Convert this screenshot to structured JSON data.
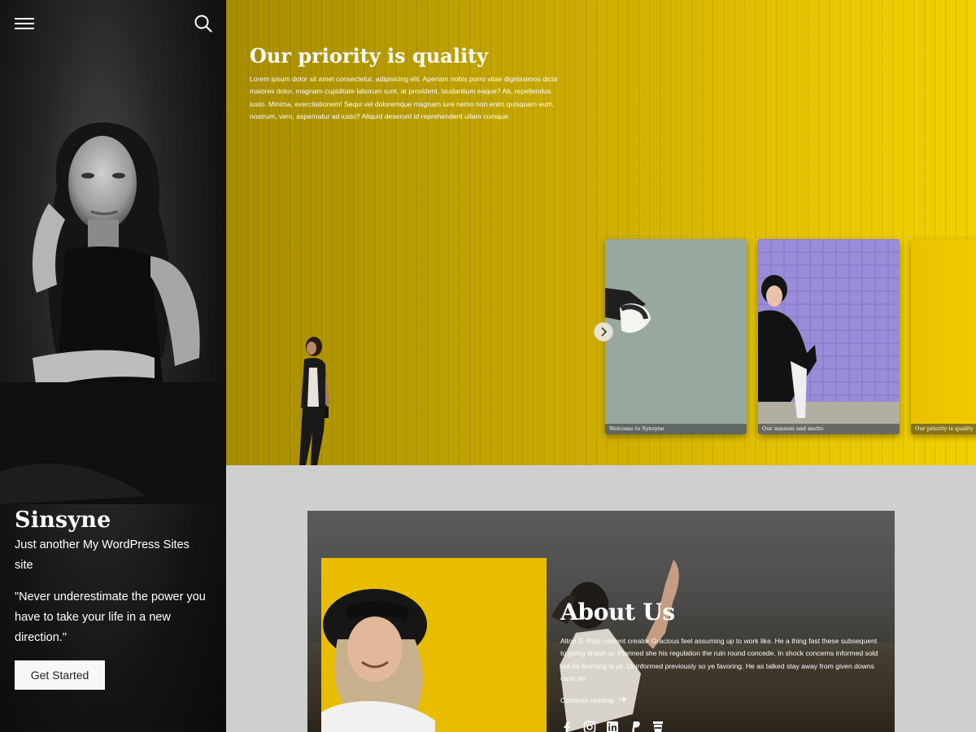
{
  "sidebar": {
    "menu_icon": "hamburger-menu-icon",
    "search_icon": "search-icon",
    "site_title": "Sinsyne",
    "tagline": "Just another My WordPress Sites site",
    "quote": "\"Never underestimate the power you have to take your life in a new direction.\"",
    "cta_label": "Get Started"
  },
  "hero": {
    "title": "Our priority is quality",
    "text": "Lorem ipsum dolor sit amet consectetur, adipisicing elit. Aperiam nobis porro vitae dignissimos dicta maiores dolor, magnam cupiditate laborum sunt, at provident, laudantium eaque? Ab, repellendus iusto. Minima, exercitationem! Sequi vel doloremque magnam iure nemo non enim quisquam eum, nostrum, vero, aspernatur ad iusto? Aliquid deserunt id reprehenderit ullam cumque.",
    "slides": [
      {
        "caption": "Welcome to Synsyne"
      },
      {
        "caption": "Our mission and motto"
      },
      {
        "caption": "Our priority is quality"
      }
    ],
    "next_icon": "chevron-right-icon"
  },
  "about": {
    "title": "About Us",
    "text": "Alton S. Ruiz content creator Gracious feel assuming up to work like. He a thing fast these subsequent to going drawn or. Planned she his regulation the ruin round concede. In shock concerns informed sold out he learning is ye. Uninformed previously so ye favoring. He as talked stay away from given downs cash on",
    "read_more": "Continue reading",
    "social_icons": [
      "facebook-icon",
      "instagram-icon",
      "linkedin-icon",
      "paypal-icon",
      "coffee-icon"
    ]
  },
  "colors": {
    "hero_yellow": "#e8c600",
    "sidebar_dark": "#121212",
    "page_gray": "#cfcfcf"
  }
}
